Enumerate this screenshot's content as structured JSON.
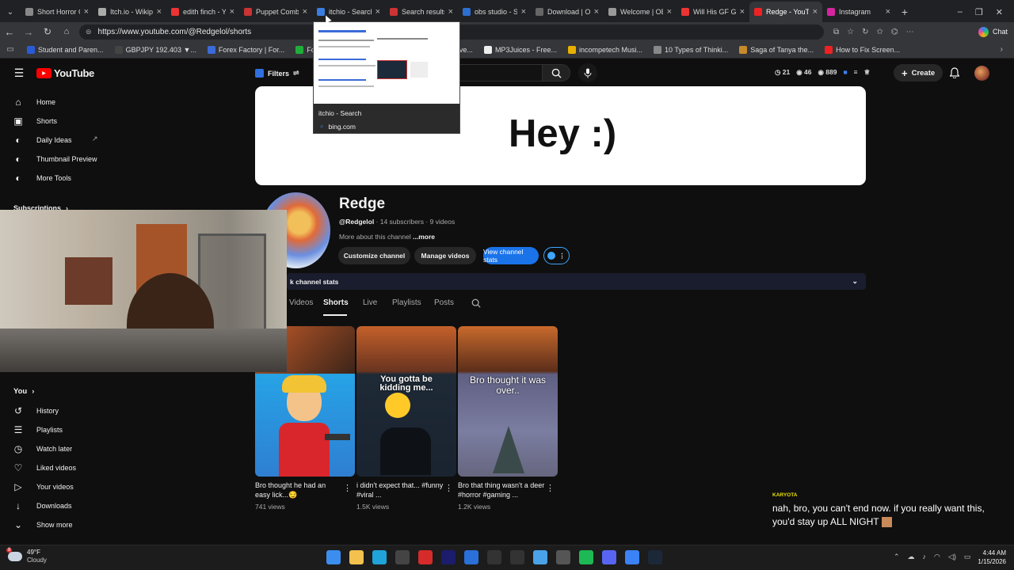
{
  "browser": {
    "tabs": [
      {
        "title": "Short Horror G",
        "color": "#888"
      },
      {
        "title": "Itch.io - Wikipe",
        "color": "#aaa"
      },
      {
        "title": "edith finch - Yo",
        "color": "#e33"
      },
      {
        "title": "Puppet Combo",
        "color": "#c33"
      },
      {
        "title": "itchio - Search",
        "color": "#3a7de0"
      },
      {
        "title": "Search results f",
        "color": "#c33"
      },
      {
        "title": "obs studio - Se",
        "color": "#2d6fd0"
      },
      {
        "title": "Download | OB",
        "color": "#666"
      },
      {
        "title": "Welcome | OBS",
        "color": "#999"
      },
      {
        "title": "Will His GF Get",
        "color": "#e33"
      },
      {
        "title": "Redge - YouTub",
        "color": "#e22"
      },
      {
        "title": "Instagram",
        "color": "#d6249f"
      }
    ],
    "url": "https://www.youtube.com/@Redgelol/shorts",
    "chat_label": "Chat",
    "bookmarks": [
      {
        "label": "Student and Paren...",
        "color": "#2a5bd7"
      },
      {
        "label": "GBPJPY 192.403 ▼...",
        "color": "#444"
      },
      {
        "label": "Forex Factory | For...",
        "color": "#3a6bd8"
      },
      {
        "label": "Forex Ma",
        "color": "#1fae3a"
      },
      {
        "label": "r: Kim...",
        "color": "#555"
      },
      {
        "label": "URL to MP4 Conve...",
        "color": "#444"
      },
      {
        "label": "MP3Juices - Free...",
        "color": "#eee"
      },
      {
        "label": "incompetech Musi...",
        "color": "#e8b100"
      },
      {
        "label": "10 Types of Thinki...",
        "color": "#888"
      },
      {
        "label": "Saga of Tanya the...",
        "color": "#c98a2a"
      },
      {
        "label": "How to Fix Screen...",
        "color": "#e22"
      }
    ],
    "tab_preview": {
      "title": "itchio - Search",
      "domain": "bing.com"
    }
  },
  "youtube": {
    "logo": "YouTube",
    "filters_label": "Filters",
    "stats": {
      "a": "21",
      "b": "46",
      "c": "889"
    },
    "create_label": "Create",
    "sidebar": {
      "items": [
        "Home",
        "Shorts",
        "Daily Ideas",
        "Thumbnail Preview",
        "More Tools"
      ],
      "subscriptions_label": "Subscriptions",
      "you_label": "You",
      "you_items": [
        "History",
        "Playlists",
        "Watch later",
        "Liked videos",
        "Your videos",
        "Downloads",
        "Show more"
      ]
    },
    "banner_text": "Hey :)",
    "channel": {
      "name": "Redge",
      "handle": "@Redgelol",
      "meta": " · 14 subscribers · 9 videos",
      "about": "More about this channel",
      "more": "...more",
      "buttons": [
        "Customize channel",
        "Manage videos",
        "View channel stats"
      ],
      "stats_bar": "k channel stats"
    },
    "tabs": [
      "Videos",
      "Shorts",
      "Live",
      "Playlists",
      "Posts"
    ],
    "shorts": [
      {
        "title": "Bro thought he had an easy lick...😏",
        "views": "741 views",
        "overlay": ""
      },
      {
        "title": "i didn't expect that... #funny #viral ...",
        "views": "1.5K views",
        "overlay": "You gotta be kidding me..."
      },
      {
        "title": "Bro that thing wasn't a deer #horror #gaming ...",
        "views": "1.2K views",
        "overlay": "Bro thought it was over.."
      }
    ]
  },
  "chat": {
    "user": "KARYOTA",
    "message": "nah, bro, you can't end now. if you really want this, you'd stay up ALL NIGHT"
  },
  "taskbar": {
    "temp": "49°F",
    "weather": "Cloudy",
    "badge": "8",
    "time": "4:44 AM",
    "date": "1/15/2026"
  }
}
